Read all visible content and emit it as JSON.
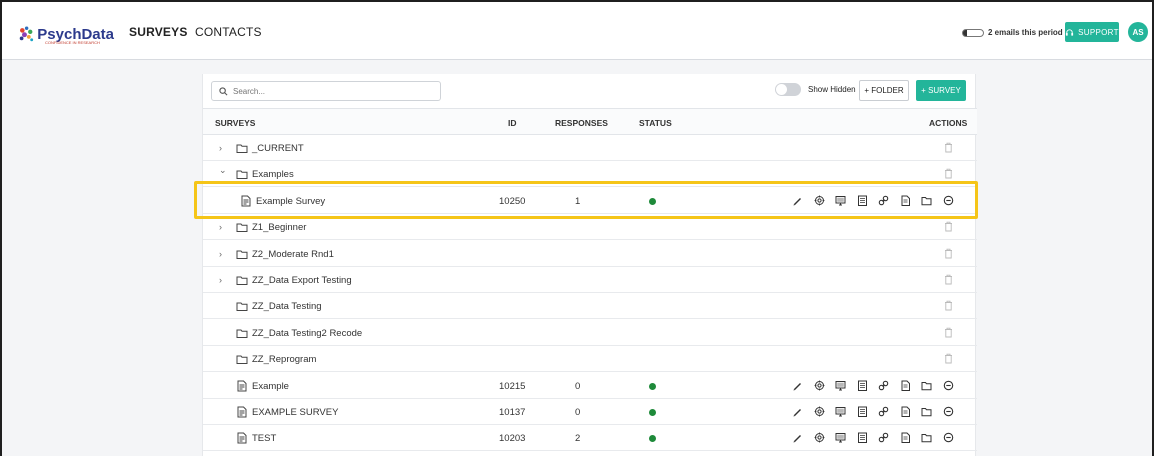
{
  "header": {
    "logo_text": "PsychData",
    "logo_tagline": "CONFIDENCE IN RESEARCH",
    "nav": [
      "SURVEYS",
      "CONTACTS"
    ],
    "emails_text": "2 emails this period",
    "support_label": "SUPPORT",
    "avatar_initials": "AS"
  },
  "toolbar": {
    "search_placeholder": "Search...",
    "show_hidden_label": "Show Hidden",
    "show_hidden_on": false,
    "folder_button": "+ FOLDER",
    "survey_button": "+ SURVEY"
  },
  "table": {
    "columns": [
      "SURVEYS",
      "ID",
      "RESPONSES",
      "STATUS",
      "ACTIONS"
    ],
    "rows": [
      {
        "kind": "folder",
        "name": "_CURRENT",
        "expander": ">",
        "id": "",
        "responses": "",
        "status": ""
      },
      {
        "kind": "folder",
        "name": "Examples",
        "expander": "v",
        "id": "",
        "responses": "",
        "status": ""
      },
      {
        "kind": "survey",
        "name": "Example Survey",
        "expander": "",
        "id": "10250",
        "responses": "1",
        "status": "active"
      },
      {
        "kind": "folder",
        "name": "Z1_Beginner",
        "expander": ">",
        "id": "",
        "responses": "",
        "status": ""
      },
      {
        "kind": "folder",
        "name": "Z2_Moderate Rnd1",
        "expander": ">",
        "id": "",
        "responses": "",
        "status": ""
      },
      {
        "kind": "folder",
        "name": "ZZ_Data Export Testing",
        "expander": ">",
        "id": "",
        "responses": "",
        "status": ""
      },
      {
        "kind": "folder",
        "name": "ZZ_Data Testing",
        "expander": "",
        "id": "",
        "responses": "",
        "status": ""
      },
      {
        "kind": "folder",
        "name": "ZZ_Data Testing2 Recode",
        "expander": "",
        "id": "",
        "responses": "",
        "status": ""
      },
      {
        "kind": "folder",
        "name": "ZZ_Reprogram",
        "expander": "",
        "id": "",
        "responses": "",
        "status": ""
      },
      {
        "kind": "survey",
        "name": "Example",
        "expander": "",
        "id": "10215",
        "responses": "0",
        "status": "active"
      },
      {
        "kind": "survey",
        "name": "EXAMPLE SURVEY",
        "expander": "",
        "id": "10137",
        "responses": "0",
        "status": "active"
      },
      {
        "kind": "survey",
        "name": "TEST",
        "expander": "",
        "id": "10203",
        "responses": "2",
        "status": "active"
      }
    ],
    "survey_actions": [
      "edit-icon",
      "target-icon",
      "preview-icon",
      "report-icon",
      "link-icon",
      "document-icon",
      "folder-move-icon",
      "deactivate-icon"
    ]
  },
  "colors": {
    "accent": "#23b59a",
    "status_active": "#1e8a3a",
    "highlight": "#f5c518",
    "logo": "#2c3a8c"
  }
}
